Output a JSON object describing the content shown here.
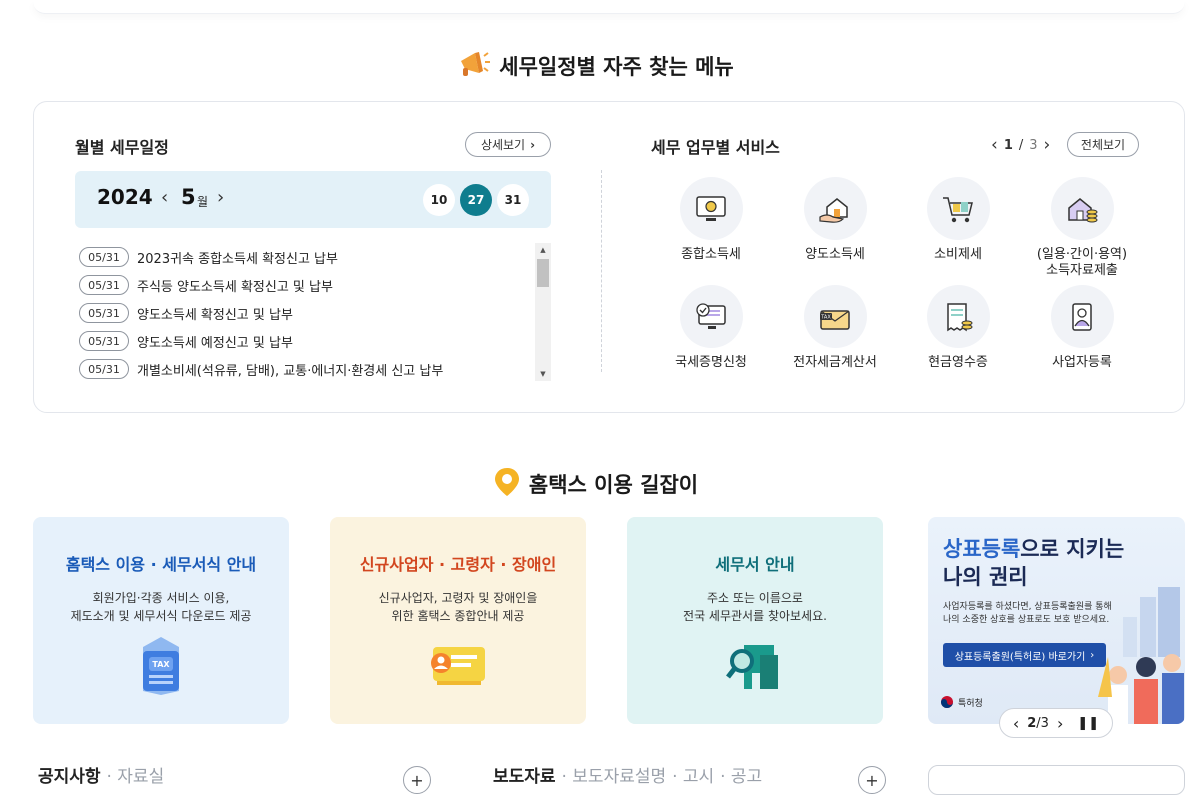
{
  "section1": {
    "title": "세무일정별 자주 찾는 메뉴",
    "icon": "megaphone-icon"
  },
  "schedule": {
    "title": "월별 세무일정",
    "detail_btn": "상세보기",
    "year": "2024",
    "month": "5",
    "month_unit": "월",
    "days": [
      "10",
      "27",
      "31"
    ],
    "active_day": "27",
    "items": [
      {
        "date": "05/31",
        "text": "2023귀속 종합소득세 확정신고 납부"
      },
      {
        "date": "05/31",
        "text": "주식등 양도소득세 확정신고 및 납부"
      },
      {
        "date": "05/31",
        "text": "양도소득세 확정신고 및 납부"
      },
      {
        "date": "05/31",
        "text": "양도소득세 예정신고 및 납부"
      },
      {
        "date": "05/31",
        "text": "개별소비세(석유류, 담배), 교통·에너지·환경세 신고 납부"
      }
    ]
  },
  "services": {
    "title": "세무 업무별 서비스",
    "page_current": "1",
    "page_total": "3",
    "all_btn": "전체보기",
    "items": [
      {
        "label": "종합소득세",
        "icon": "monitor-coin-icon"
      },
      {
        "label": "양도소득세",
        "icon": "house-hand-icon"
      },
      {
        "label": "소비제세",
        "icon": "shopping-cart-icon"
      },
      {
        "label": "(일용·간이·용역)\n소득자료제출",
        "icon": "house-coins-icon"
      },
      {
        "label": "국세증명신청",
        "icon": "certificate-monitor-icon"
      },
      {
        "label": "전자세금계산서",
        "icon": "tax-envelope-icon"
      },
      {
        "label": "현금영수증",
        "icon": "receipt-icon"
      },
      {
        "label": "사업자등록",
        "icon": "person-document-icon"
      }
    ]
  },
  "section2": {
    "title": "홈택스 이용 길잡이",
    "icon": "location-pin-icon"
  },
  "guides": [
    {
      "title": "홈택스 이용 · 세무서식 안내",
      "desc": "회원가입·각종 서비스 이용,\n제도소개 및 세무서식 다운로드 제공",
      "color": "#1a5bb8",
      "bg": "#e6f1fb"
    },
    {
      "title": "신규사업자 · 고령자 · 장애인",
      "desc": "신규사업자, 고령자 및 장애인을\n위한 홈택스 종합안내 제공",
      "color": "#d2461f",
      "bg": "#fbf3df"
    },
    {
      "title": "세무서 안내",
      "desc": "주소 또는 이름으로\n전국 세무관서를 찾아보세요.",
      "color": "#0f6f7a",
      "bg": "#e0f3f3"
    }
  ],
  "banner": {
    "title_blue": "상표등록",
    "title_rest": "으로 지키는",
    "title_line2": "나의 권리",
    "desc": "사업자등록를 하셨다면, 상표등록출원를 통해\n나의 소중한 상호를 상표로도 보호 받으세요.",
    "btn": "상표등록출원(특허로) 바로가기",
    "logo": "특허청",
    "page_current": "2",
    "page_total": "3"
  },
  "bottom": {
    "notice": "공지사항",
    "archive": "자료실",
    "press": "보도자료",
    "press_desc": "보도자료설명",
    "notice2": "고시",
    "announce": "공고"
  }
}
